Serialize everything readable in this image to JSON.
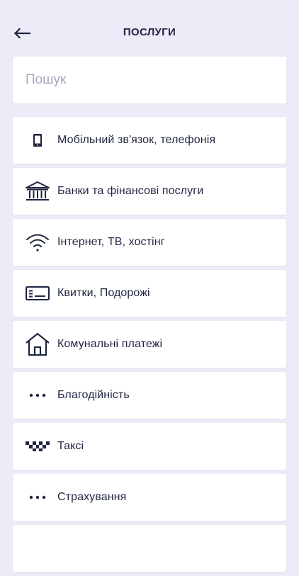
{
  "header": {
    "title": "ПОСЛУГИ",
    "back_icon": "arrow-left-icon"
  },
  "search": {
    "placeholder": "Пошук",
    "value": ""
  },
  "categories": [
    {
      "label": "Мобільний зв'язок, телефонія",
      "icon": "mobile-phone-icon"
    },
    {
      "label": "Банки та фінансові послуги",
      "icon": "bank-icon"
    },
    {
      "label": "Інтернет, ТВ, хостінг",
      "icon": "wifi-icon"
    },
    {
      "label": "Квитки, Подорожі",
      "icon": "ticket-icon"
    },
    {
      "label": "Комунальні платежі",
      "icon": "house-icon"
    },
    {
      "label": "Благодійність",
      "icon": "more-dots-icon"
    },
    {
      "label": "Таксі",
      "icon": "taxi-checker-icon"
    },
    {
      "label": "Страхування",
      "icon": "more-dots-icon"
    }
  ],
  "colors": {
    "background": "#ecebf7",
    "card": "#ffffff",
    "text": "#1f2540",
    "placeholder": "#a4a7b8"
  }
}
